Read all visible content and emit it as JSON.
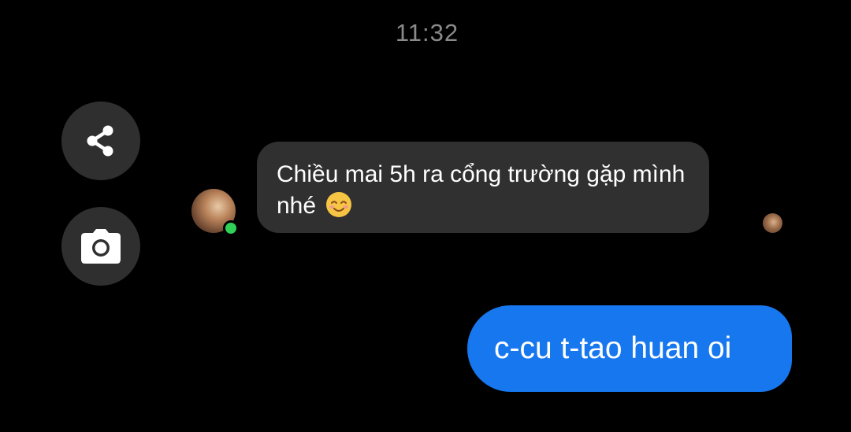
{
  "chat": {
    "timestamp": "11:32",
    "incoming_message": {
      "text": "Chiều mai 5h ra cổng trường gặp mình nhé",
      "emoji": "smiling-face-with-smiling-eyes-emoji",
      "sender_online": true
    },
    "outgoing_message": {
      "text": "c-cu t-tao huan oi"
    }
  },
  "actions": {
    "share_icon": "share-icon",
    "camera_icon": "camera-icon"
  },
  "colors": {
    "background": "#000000",
    "incoming_bubble": "#303030",
    "outgoing_bubble": "#1677ef",
    "online_indicator": "#31d158",
    "action_button": "#2f2f2f"
  }
}
